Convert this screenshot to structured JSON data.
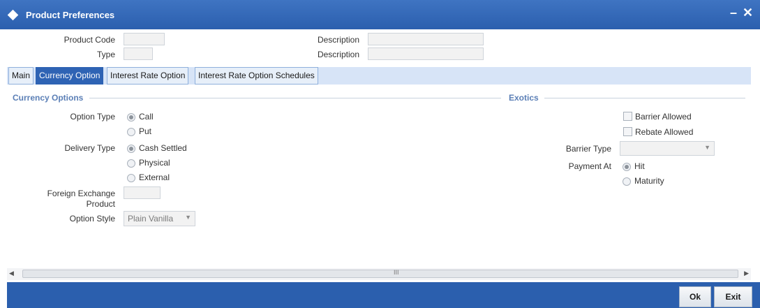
{
  "window": {
    "title": "Product Preferences",
    "minimize": "–",
    "close": "✕"
  },
  "header": {
    "product_code_label": "Product Code",
    "type_label": "Type",
    "description_label_1": "Description",
    "description_label_2": "Description",
    "product_code_value": "",
    "type_value": "",
    "description_value_1": "",
    "description_value_2": ""
  },
  "tabs": [
    {
      "label": "Main",
      "active": false
    },
    {
      "label": "Currency Option",
      "active": true
    },
    {
      "label": "Interest Rate Option",
      "active": false
    },
    {
      "label": "Interest Rate Option Schedules",
      "active": false
    }
  ],
  "currency_options": {
    "title": "Currency Options",
    "option_type_label": "Option Type",
    "option_type_options": [
      {
        "label": "Call",
        "selected": true
      },
      {
        "label": "Put",
        "selected": false
      }
    ],
    "delivery_type_label": "Delivery Type",
    "delivery_type_options": [
      {
        "label": "Cash Settled",
        "selected": true
      },
      {
        "label": "Physical",
        "selected": false
      },
      {
        "label": "External",
        "selected": false
      }
    ],
    "fx_product_label_1": "Foreign Exchange",
    "fx_product_label_2": "Product",
    "fx_product_value": "",
    "option_style_label": "Option Style",
    "option_style_value": "Plain Vanilla"
  },
  "exotics": {
    "title": "Exotics",
    "barrier_allowed_label": "Barrier Allowed",
    "barrier_allowed_checked": false,
    "rebate_allowed_label": "Rebate Allowed",
    "rebate_allowed_checked": false,
    "barrier_type_label": "Barrier Type",
    "barrier_type_value": "",
    "payment_at_label": "Payment At",
    "payment_at_options": [
      {
        "label": "Hit",
        "selected": true
      },
      {
        "label": "Maturity",
        "selected": false
      }
    ]
  },
  "scrollbar": {
    "left_arrow": "◀",
    "right_arrow": "▶",
    "grip": "III"
  },
  "footer": {
    "ok_label": "Ok",
    "exit_label": "Exit"
  },
  "colors": {
    "title_bar": "#2b5fae",
    "active_tab": "#2e63b4",
    "section_title": "#5b7fb6"
  },
  "icons": {
    "window": "diamond-icon",
    "dropdown": "chevron-down-icon"
  }
}
